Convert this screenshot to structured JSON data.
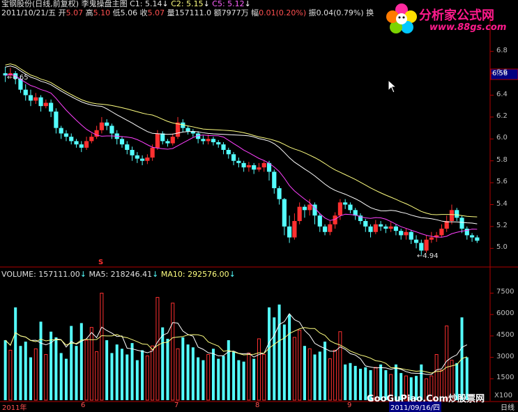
{
  "header": {
    "line1": {
      "stock": "宝钢股份(日线,前复权)",
      "indicator": "李鬼操盘主图",
      "c1": "C1: 5.14",
      "c2": "C2: 5.15",
      "c5": "C5: 5.12"
    },
    "line2": {
      "date": "2011/10/21/五",
      "open_label": "开",
      "open": "5.07",
      "high_label": "高",
      "high": "5.10",
      "low_label": "低",
      "low": "5.06",
      "close_label": "收",
      "close": "5.07",
      "vol_label": "量",
      "vol": "157111.0",
      "amount_label": "额",
      "amount": "7977万",
      "change_label": "幅",
      "change": "0.01(0.20%)",
      "amp_label": "振",
      "amp": "0.04(0.79%)",
      "turnover_label": "换"
    }
  },
  "watermark": {
    "site_name": "分析家公式网",
    "site_url": "www.88gs.com",
    "bottom": "GooGuPiao.Com炒股票网"
  },
  "price_axis": {
    "ticks": [
      "6.8",
      "6.6",
      "6.4",
      "6.2",
      "6.0",
      "5.8",
      "5.6",
      "5.4",
      "5.2",
      "5.0"
    ],
    "current_price": "6.58"
  },
  "annotations": {
    "high_label": "6.65",
    "low_label": "4.94",
    "signal": "S"
  },
  "volume_panel": {
    "volume_label": "VOLUME: 157111.00",
    "ma5_label": "MA5: 218246.41",
    "ma10_label": "MA10: 292576.00",
    "ticks": [
      "7500",
      "6000",
      "4500",
      "3000",
      "1500"
    ],
    "unit": "X100"
  },
  "x_axis": {
    "labels": [
      "2011年",
      "6",
      "7",
      "8",
      "9",
      "2011/09/16/四",
      "日线"
    ]
  },
  "colors": {
    "up_candle": "#ff3030",
    "down_candle": "#54ffff",
    "ma1": "#ffffff",
    "ma2": "#ffff80",
    "ma3": "#ff40ff",
    "axis_line": "#b00000",
    "up_text": "#ff5050",
    "down_text": "#54ff54"
  },
  "chart_data": {
    "type": "candlestick",
    "ylim": [
      4.9,
      6.9
    ],
    "vol_ylim": [
      0,
      8500
    ],
    "candles": [
      [
        6.6,
        6.58,
        6.66,
        6.52
      ],
      [
        6.58,
        6.6,
        6.65,
        6.55
      ],
      [
        6.6,
        6.55,
        6.62,
        6.5
      ],
      [
        6.55,
        6.45,
        6.58,
        6.42
      ],
      [
        6.45,
        6.4,
        6.5,
        6.35
      ],
      [
        6.4,
        6.35,
        6.45,
        6.3
      ],
      [
        6.35,
        6.38,
        6.42,
        6.32
      ],
      [
        6.38,
        6.3,
        6.4,
        6.25
      ],
      [
        6.3,
        6.33,
        6.36,
        6.28
      ],
      [
        6.33,
        6.25,
        6.36,
        6.2
      ],
      [
        6.25,
        6.1,
        6.28,
        6.05
      ],
      [
        6.1,
        6.05,
        6.12,
        6.0
      ],
      [
        6.05,
        6.02,
        6.08,
        5.98
      ],
      [
        6.02,
        5.98,
        6.05,
        5.95
      ],
      [
        5.98,
        5.95,
        6.0,
        5.92
      ],
      [
        5.95,
        5.92,
        5.98,
        5.88
      ],
      [
        5.92,
        5.98,
        6.02,
        5.9
      ],
      [
        5.98,
        6.02,
        6.05,
        5.96
      ],
      [
        6.02,
        6.08,
        6.12,
        6.0
      ],
      [
        6.08,
        6.15,
        6.2,
        6.05
      ],
      [
        6.15,
        6.12,
        6.18,
        6.08
      ],
      [
        6.12,
        6.05,
        6.14,
        6.0
      ],
      [
        6.05,
        6.0,
        6.08,
        5.95
      ],
      [
        6.0,
        5.95,
        6.02,
        5.92
      ],
      [
        5.95,
        5.9,
        5.98,
        5.86
      ],
      [
        5.9,
        5.85,
        5.93,
        5.8
      ],
      [
        5.85,
        5.82,
        5.88,
        5.78
      ],
      [
        5.82,
        5.8,
        5.85,
        5.76
      ],
      [
        5.8,
        5.83,
        5.86,
        5.77
      ],
      [
        5.83,
        5.92,
        5.95,
        5.8
      ],
      [
        5.92,
        6.05,
        6.08,
        5.9
      ],
      [
        6.05,
        5.98,
        6.07,
        5.95
      ],
      [
        5.98,
        5.96,
        6.0,
        5.93
      ],
      [
        5.96,
        6.02,
        6.05,
        5.94
      ],
      [
        6.02,
        6.15,
        6.2,
        6.0
      ],
      [
        6.15,
        6.1,
        6.18,
        6.06
      ],
      [
        6.1,
        6.07,
        6.12,
        6.04
      ],
      [
        6.07,
        6.05,
        6.09,
        6.02
      ],
      [
        6.05,
        6.0,
        6.07,
        5.96
      ],
      [
        6.0,
        5.98,
        6.03,
        5.95
      ],
      [
        5.98,
        6.0,
        6.04,
        5.95
      ],
      [
        6.0,
        5.97,
        6.02,
        5.94
      ],
      [
        5.97,
        5.95,
        5.99,
        5.92
      ],
      [
        5.95,
        5.9,
        5.97,
        5.86
      ],
      [
        5.9,
        5.86,
        5.92,
        5.82
      ],
      [
        5.86,
        5.8,
        5.88,
        5.76
      ],
      [
        5.8,
        5.78,
        5.83,
        5.74
      ],
      [
        5.78,
        5.74,
        5.8,
        5.7
      ],
      [
        5.74,
        5.76,
        5.79,
        5.7
      ],
      [
        5.76,
        5.72,
        5.78,
        5.68
      ],
      [
        5.72,
        5.74,
        5.78,
        5.7
      ],
      [
        5.74,
        5.78,
        5.8,
        5.7
      ],
      [
        5.78,
        5.7,
        5.8,
        5.62
      ],
      [
        5.7,
        5.55,
        5.72,
        5.5
      ],
      [
        5.55,
        5.45,
        5.57,
        5.4
      ],
      [
        5.45,
        5.2,
        5.46,
        5.12
      ],
      [
        5.2,
        5.1,
        5.3,
        5.05
      ],
      [
        5.1,
        5.25,
        5.32,
        5.08
      ],
      [
        5.25,
        5.38,
        5.42,
        5.22
      ],
      [
        5.38,
        5.35,
        5.4,
        5.28
      ],
      [
        5.35,
        5.4,
        5.45,
        5.3
      ],
      [
        5.4,
        5.3,
        5.42,
        5.22
      ],
      [
        5.3,
        5.2,
        5.32,
        5.15
      ],
      [
        5.2,
        5.15,
        5.22,
        5.12
      ],
      [
        5.15,
        5.22,
        5.25,
        5.12
      ],
      [
        5.22,
        5.3,
        5.33,
        5.18
      ],
      [
        5.3,
        5.42,
        5.45,
        5.26
      ],
      [
        5.42,
        5.4,
        5.45,
        5.36
      ],
      [
        5.4,
        5.35,
        5.42,
        5.32
      ],
      [
        5.35,
        5.3,
        5.37,
        5.26
      ],
      [
        5.3,
        5.25,
        5.32,
        5.22
      ],
      [
        5.25,
        5.2,
        5.27,
        5.15
      ],
      [
        5.2,
        5.15,
        5.22,
        5.1
      ],
      [
        5.15,
        5.22,
        5.26,
        5.13
      ],
      [
        5.22,
        5.2,
        5.25,
        5.16
      ],
      [
        5.2,
        5.18,
        5.22,
        5.14
      ],
      [
        5.18,
        5.2,
        5.24,
        5.15
      ],
      [
        5.2,
        5.16,
        5.22,
        5.12
      ],
      [
        5.16,
        5.12,
        5.18,
        5.08
      ],
      [
        5.12,
        5.15,
        5.18,
        5.08
      ],
      [
        5.15,
        5.08,
        5.17,
        5.04
      ],
      [
        5.08,
        5.05,
        5.12,
        5.0
      ],
      [
        5.05,
        4.98,
        5.08,
        4.94
      ],
      [
        4.98,
        5.08,
        5.12,
        4.96
      ],
      [
        5.08,
        5.1,
        5.15,
        5.05
      ],
      [
        5.1,
        5.12,
        5.15,
        5.06
      ],
      [
        5.12,
        5.18,
        5.22,
        5.1
      ],
      [
        5.18,
        5.25,
        5.3,
        5.15
      ],
      [
        5.25,
        5.35,
        5.4,
        5.22
      ],
      [
        5.35,
        5.28,
        5.37,
        5.25
      ],
      [
        5.28,
        5.18,
        5.3,
        5.14
      ],
      [
        5.18,
        5.12,
        5.2,
        5.08
      ],
      [
        5.12,
        5.1,
        5.14,
        5.06
      ],
      [
        5.1,
        5.07,
        5.12,
        5.05
      ]
    ],
    "volume": [
      4200,
      3500,
      6500,
      3800,
      4100,
      3000,
      3600,
      5500,
      3200,
      4800,
      4400,
      3300,
      2900,
      5200,
      3800,
      5400,
      4200,
      5100,
      3400,
      7500,
      4200,
      3300,
      3900,
      3600,
      3200,
      4000,
      2800,
      3500,
      3100,
      3800,
      7200,
      5100,
      4300,
      6800,
      3600,
      4400,
      3900,
      3700,
      3000,
      2800,
      3200,
      3600,
      2900,
      3100,
      4200,
      3400,
      2800,
      2700,
      3300,
      2900,
      4300,
      3200,
      6500,
      5800,
      6700,
      5300,
      6000,
      4400,
      4900,
      3800,
      3600,
      3200,
      3400,
      4100,
      2900,
      3500,
      4800,
      2500,
      2600,
      2400,
      2200,
      2300,
      2100,
      2300,
      2500,
      2100,
      1800,
      2500,
      1900,
      1700,
      1600,
      1700,
      2500,
      1500,
      1700,
      3200,
      2100,
      5200,
      2800,
      2600,
      5800,
      3000
    ],
    "ma_lines": [
      "white",
      "yellow",
      "magenta"
    ]
  }
}
